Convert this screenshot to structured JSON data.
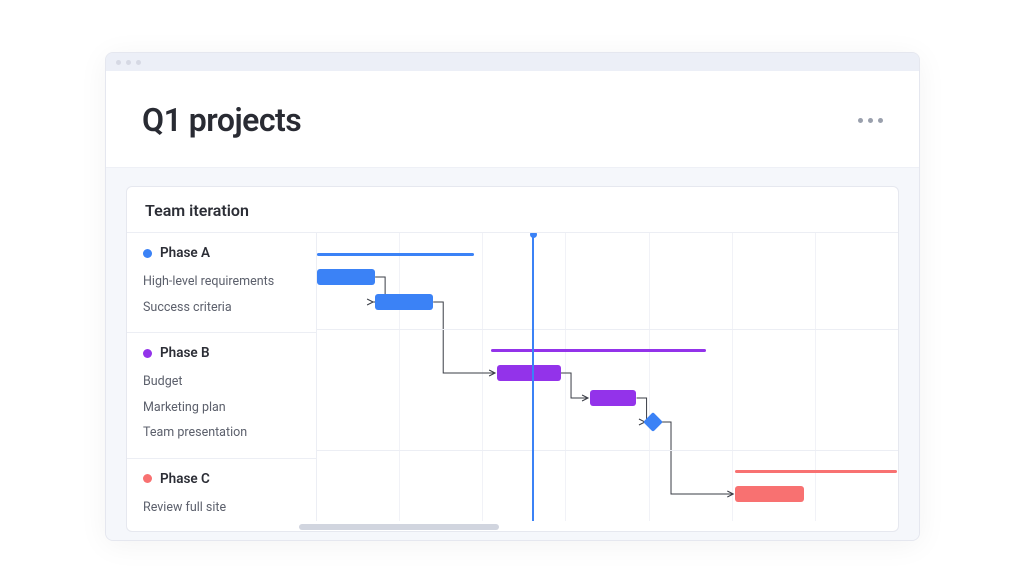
{
  "page_title": "Q1 projects",
  "card_title": "Team iteration",
  "groups": [
    {
      "name": "Phase A",
      "color": "#3b82f6",
      "summary": {
        "start": 0,
        "end": 27
      },
      "tasks": [
        {
          "name": "High-level requirements",
          "start": 0,
          "end": 10,
          "link_to": [
            1
          ]
        },
        {
          "name": "Success criteria",
          "start": 10,
          "end": 20,
          "link_to": [
            2
          ]
        }
      ]
    },
    {
      "name": "Phase B",
      "color": "#9333ea",
      "summary": {
        "start": 30,
        "end": 67
      },
      "tasks": [
        {
          "name": "Budget",
          "start": 31,
          "end": 42,
          "link_to": [
            3
          ]
        },
        {
          "name": "Marketing plan",
          "start": 47,
          "end": 55,
          "link_to": [
            4
          ]
        },
        {
          "name": "Team presentation",
          "type": "milestone",
          "at": 58,
          "link_to": [
            5
          ]
        }
      ]
    },
    {
      "name": "Phase C",
      "color": "#f87171",
      "summary": {
        "start": 72,
        "end": 100
      },
      "tasks": [
        {
          "name": "Review full site",
          "start": 72,
          "end": 84
        }
      ]
    }
  ],
  "timeline": {
    "columns": 7,
    "today_percent": 37
  },
  "chart_data": {
    "type": "gantt",
    "title": "Team iteration",
    "x_axis": {
      "unit": "relative",
      "range": [
        0,
        100
      ],
      "note": "column ticks every ~14.3 units; today marker at 37"
    },
    "today": 37,
    "phases": [
      {
        "name": "Phase A",
        "color": "#3b82f6",
        "summary_bar": [
          0,
          27
        ],
        "tasks": [
          {
            "name": "High-level requirements",
            "start": 0,
            "end": 10,
            "depends_on": null
          },
          {
            "name": "Success criteria",
            "start": 10,
            "end": 20,
            "depends_on": "High-level requirements"
          }
        ]
      },
      {
        "name": "Phase B",
        "color": "#9333ea",
        "summary_bar": [
          30,
          67
        ],
        "tasks": [
          {
            "name": "Budget",
            "start": 31,
            "end": 42,
            "depends_on": "Success criteria"
          },
          {
            "name": "Marketing plan",
            "start": 47,
            "end": 55,
            "depends_on": "Budget"
          },
          {
            "name": "Team presentation",
            "type": "milestone",
            "at": 58,
            "depends_on": "Marketing plan"
          }
        ]
      },
      {
        "name": "Phase C",
        "color": "#f87171",
        "summary_bar": [
          72,
          100
        ],
        "tasks": [
          {
            "name": "Review full site",
            "start": 72,
            "end": 84,
            "depends_on": "Team presentation"
          }
        ]
      }
    ]
  }
}
